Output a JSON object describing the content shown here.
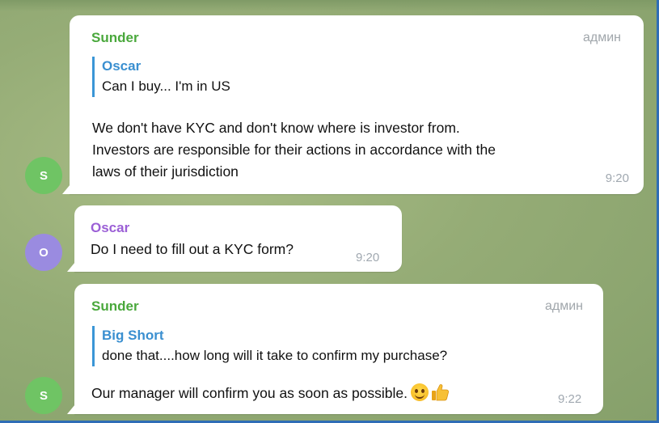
{
  "messages": [
    {
      "sender": "Sunder",
      "avatar_letter": "S",
      "role": "админ",
      "reply": {
        "name": "Oscar",
        "text": "Can I buy... I'm in US"
      },
      "lines": [
        "We don't have KYC and don't know where is investor from.",
        "Investors are responsible for their actions in accordance with the",
        "laws of their jurisdiction"
      ],
      "time": "9:20"
    },
    {
      "sender": "Oscar",
      "avatar_letter": "O",
      "text": "Do I need to fill out a KYC form?",
      "time": "9:20"
    },
    {
      "sender": "Sunder",
      "avatar_letter": "S",
      "role": "админ",
      "reply": {
        "name": "Big Short",
        "text": "done that....how long will it take to confirm my purchase?"
      },
      "text": "Our manager will confirm you as soon as possible.",
      "emojis": [
        "smiling-face-emoji",
        "thumbs-up-emoji"
      ],
      "time": "9:22"
    }
  ],
  "colors": {
    "admin_name": "#4aa83c",
    "member_name": "#9b5fd6",
    "reply_name": "#3a8fd0",
    "avatar_s": "#6fc464",
    "avatar_o": "#9a8be0"
  }
}
